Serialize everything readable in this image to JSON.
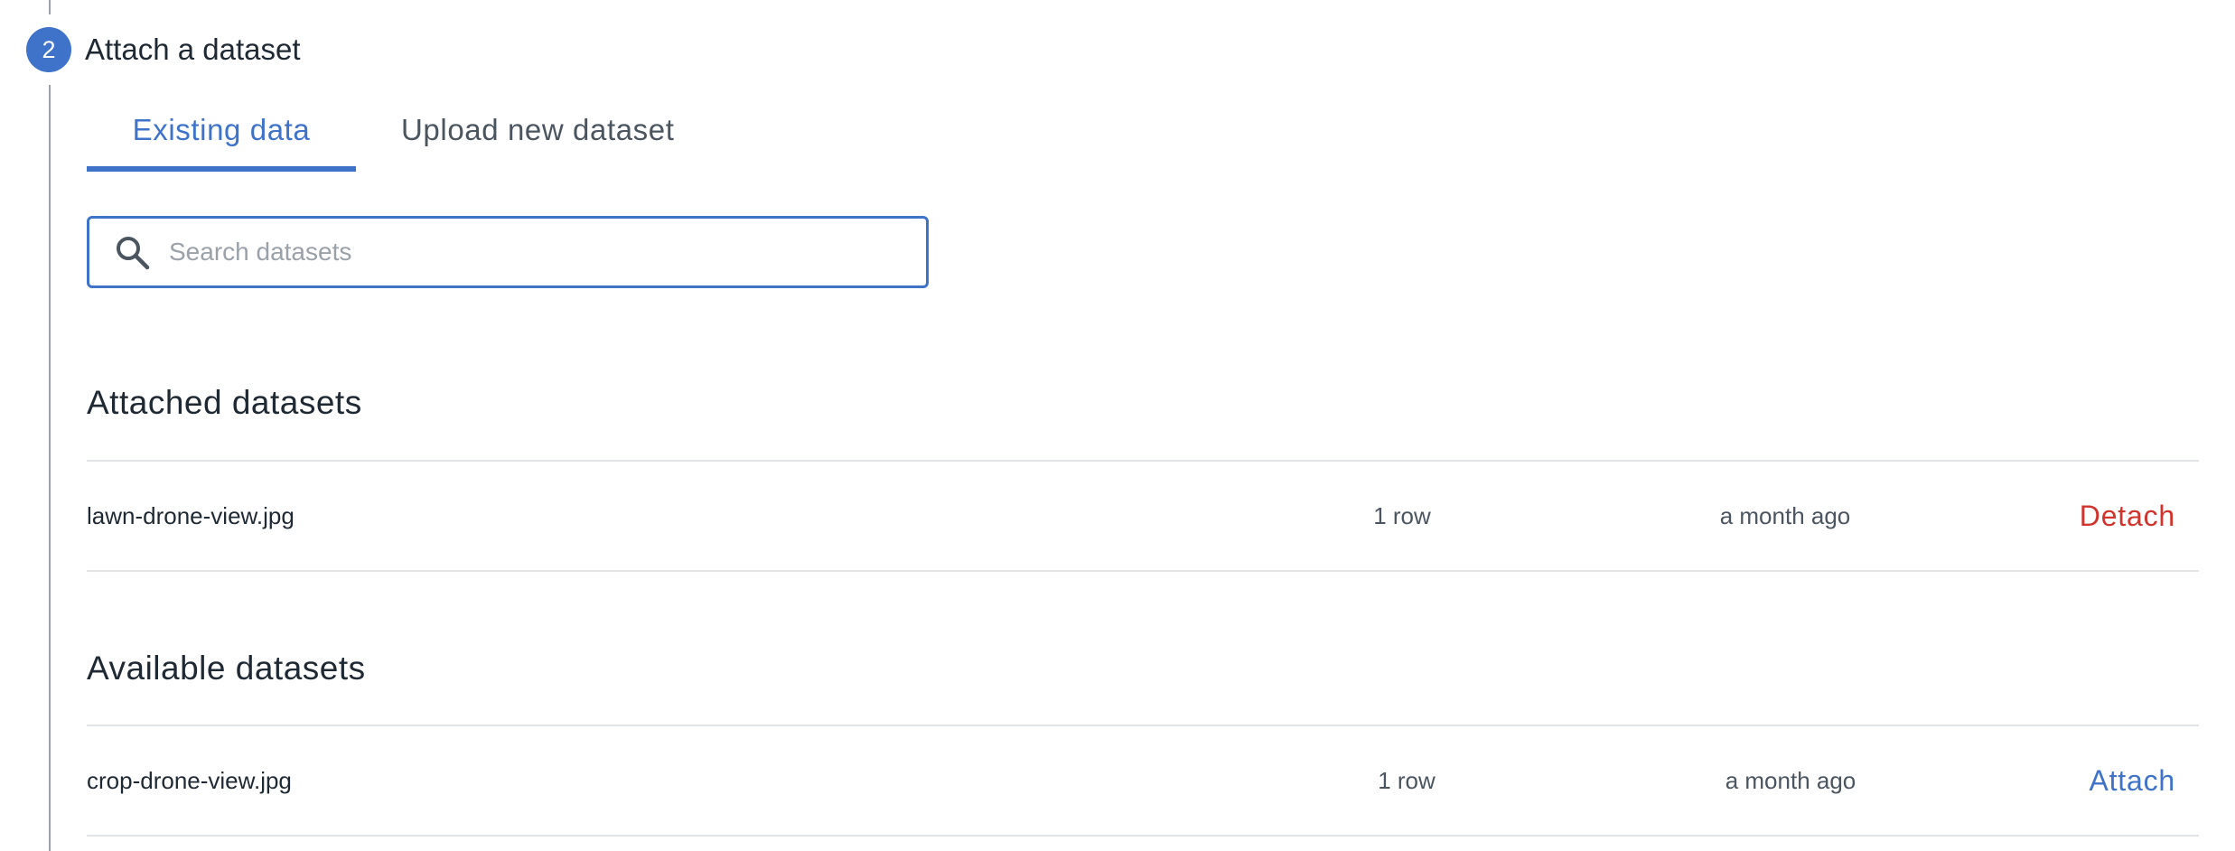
{
  "step": {
    "number": "2",
    "title": "Attach a dataset"
  },
  "tabs": [
    {
      "label": "Existing data",
      "active": true
    },
    {
      "label": "Upload new dataset",
      "active": false
    }
  ],
  "search": {
    "placeholder": "Search datasets",
    "value": ""
  },
  "attached": {
    "title": "Attached datasets",
    "rows": [
      {
        "name": "lawn-drone-view.jpg",
        "rows": "1 row",
        "updated": "a month ago",
        "action": "Detach"
      }
    ]
  },
  "available": {
    "title": "Available datasets",
    "rows": [
      {
        "name": "crop-drone-view.jpg",
        "rows": "1 row",
        "updated": "a month ago",
        "action": "Attach"
      }
    ]
  },
  "colors": {
    "accent": "#3f73c9",
    "danger": "#d0342c",
    "divider": "#e2e5e8"
  },
  "icons": {
    "search": "search-icon"
  }
}
